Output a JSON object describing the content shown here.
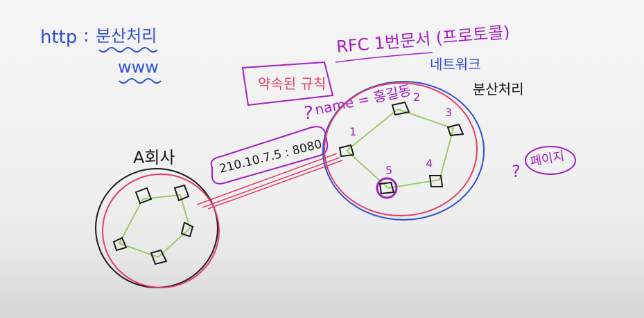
{
  "labels": {
    "http": "http",
    "colon": ":",
    "http_desc": "분산처리",
    "www": "www",
    "promise": "약속된 규칙",
    "rfc": "RFC 1번문서 (프로토콜)",
    "network": "네트워크",
    "distributed": "분산처리",
    "a_company": "A회사",
    "address": "210.10.7.5 : 8080",
    "name_eq": "name = 홍길동",
    "qmark": "?",
    "page_qmark": "?",
    "page": "페이지",
    "node_1": "1",
    "node_2": "2",
    "node_3": "3",
    "node_4": "4",
    "node_5": "5"
  },
  "colors": {
    "blue": "#2f4fd0",
    "magenta": "#a21fc0",
    "pink": "#e43c64",
    "green": "#9ccb63",
    "black": "#1a1a1a"
  }
}
